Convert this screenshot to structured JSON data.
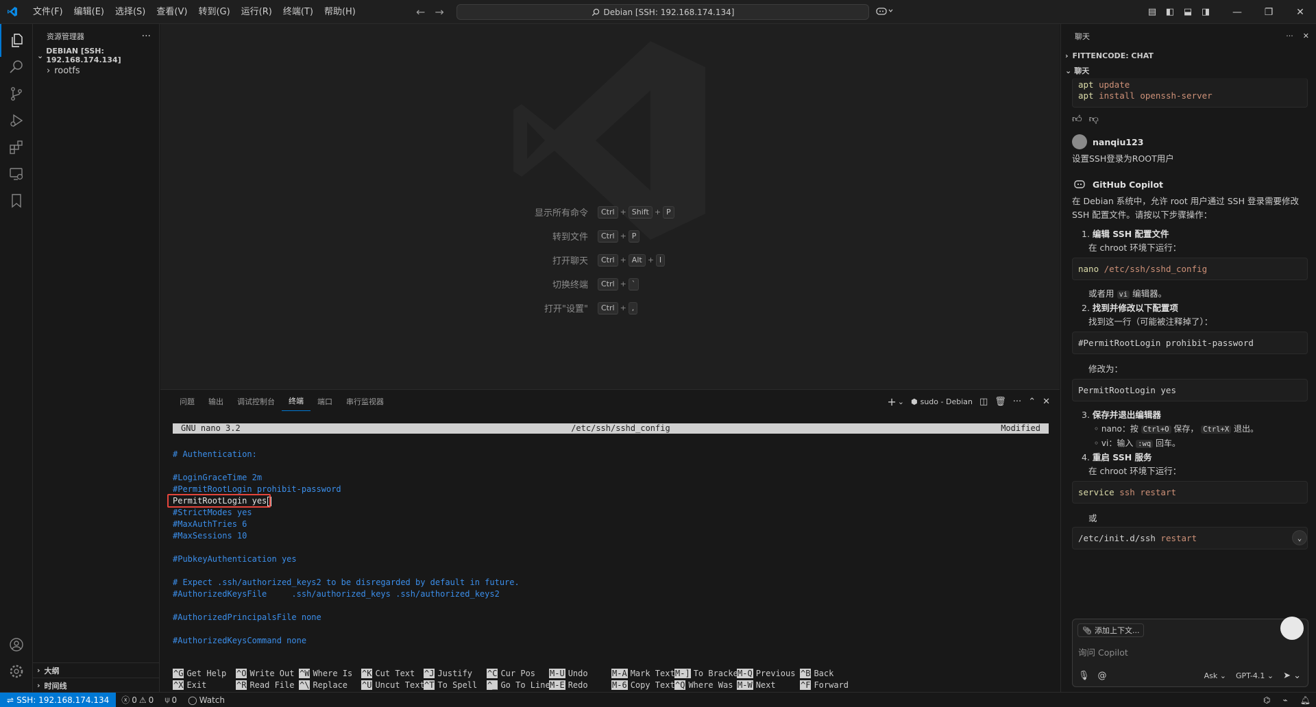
{
  "titlebar": {
    "menu": [
      "文件(F)",
      "编辑(E)",
      "选择(S)",
      "查看(V)",
      "转到(G)",
      "运行(R)",
      "终端(T)",
      "帮助(H)"
    ],
    "search_text": "Debian [SSH: 192.168.174.134]"
  },
  "sidebar": {
    "title": "资源管理器",
    "root": "DEBIAN [SSH: 192.168.174.134]",
    "items": [
      "rootfs"
    ],
    "outline": "大纲",
    "timeline": "时间线"
  },
  "editor": {
    "shortcuts": [
      {
        "label": "显示所有命令",
        "keys": [
          "Ctrl",
          "Shift",
          "P"
        ]
      },
      {
        "label": "转到文件",
        "keys": [
          "Ctrl",
          "P"
        ]
      },
      {
        "label": "打开聊天",
        "keys": [
          "Ctrl",
          "Alt",
          "I"
        ]
      },
      {
        "label": "切换终端",
        "keys": [
          "Ctrl",
          "`"
        ]
      },
      {
        "label": "打开\"设置\"",
        "keys": [
          "Ctrl",
          ","
        ]
      }
    ]
  },
  "panel": {
    "tabs": [
      "问题",
      "输出",
      "调试控制台",
      "终端",
      "端口",
      "串行监视器"
    ],
    "active_tab": "终端",
    "terminal_name": "sudo - Debian"
  },
  "terminal": {
    "nano_version": "GNU nano 3.2",
    "file": "/etc/ssh/sshd_config",
    "status": "Modified",
    "lines": [
      {
        "text": "",
        "style": "w"
      },
      {
        "text": "# Authentication:",
        "style": "c"
      },
      {
        "text": "",
        "style": "w"
      },
      {
        "text": "#LoginGraceTime 2m",
        "style": "c"
      },
      {
        "text": "#PermitRootLogin prohibit-password",
        "style": "c"
      },
      {
        "text": "PermitRootLogin yes",
        "style": "w"
      },
      {
        "text": "#StrictModes yes",
        "style": "c"
      },
      {
        "text": "#MaxAuthTries 6",
        "style": "c"
      },
      {
        "text": "#MaxSessions 10",
        "style": "c"
      },
      {
        "text": "",
        "style": "w"
      },
      {
        "text": "#PubkeyAuthentication yes",
        "style": "c"
      },
      {
        "text": "",
        "style": "w"
      },
      {
        "text": "# Expect .ssh/authorized_keys2 to be disregarded by default in future.",
        "style": "c"
      },
      {
        "text": "#AuthorizedKeysFile     .ssh/authorized_keys .ssh/authorized_keys2",
        "style": "c"
      },
      {
        "text": "",
        "style": "w"
      },
      {
        "text": "#AuthorizedPrincipalsFile none",
        "style": "c"
      },
      {
        "text": "",
        "style": "w"
      },
      {
        "text": "#AuthorizedKeysCommand none",
        "style": "c"
      }
    ],
    "help": [
      [
        {
          "k": "^G",
          "t": "Get Help"
        },
        {
          "k": "^X",
          "t": "Exit"
        }
      ],
      [
        {
          "k": "^O",
          "t": "Write Out"
        },
        {
          "k": "^R",
          "t": "Read File"
        }
      ],
      [
        {
          "k": "^W",
          "t": "Where Is"
        },
        {
          "k": "^\\",
          "t": "Replace"
        }
      ],
      [
        {
          "k": "^K",
          "t": "Cut Text"
        },
        {
          "k": "^U",
          "t": "Uncut Text"
        }
      ],
      [
        {
          "k": "^J",
          "t": "Justify"
        },
        {
          "k": "^T",
          "t": "To Spell"
        }
      ],
      [
        {
          "k": "^C",
          "t": "Cur Pos"
        },
        {
          "k": "^_",
          "t": "Go To Line"
        }
      ],
      [
        {
          "k": "M-U",
          "t": "Undo"
        },
        {
          "k": "M-E",
          "t": "Redo"
        }
      ],
      [
        {
          "k": "M-A",
          "t": "Mark Text"
        },
        {
          "k": "M-6",
          "t": "Copy Text"
        }
      ],
      [
        {
          "k": "M-]",
          "t": "To Bracket"
        },
        {
          "k": "^Q",
          "t": "Where Was"
        }
      ],
      [
        {
          "k": "M-Q",
          "t": "Previous"
        },
        {
          "k": "M-W",
          "t": "Next"
        }
      ],
      [
        {
          "k": "^B",
          "t": "Back"
        },
        {
          "k": "^F",
          "t": "Forward"
        }
      ]
    ]
  },
  "chat": {
    "title": "聊天",
    "fittencode": "FITTENCODE: CHAT",
    "section": "聊天",
    "code_top": {
      "l1_cmd": "apt",
      "l1_arg": "update",
      "l2_cmd": "apt",
      "l2_arg": "install openssh-server"
    },
    "user_name": "nanqiu123",
    "user_msg": "设置SSH登录为ROOT用户",
    "bot_name": "GitHub Copilot",
    "intro": "在 Debian 系统中，允许 root 用户通过 SSH 登录需要修改 SSH 配置文件。请按以下步骤操作：",
    "step1_title": "编辑 SSH 配置文件",
    "step1_sub": "在 chroot 环境下运行：",
    "code1_cmd": "nano",
    "code1_arg": "/etc/ssh/sshd_config",
    "or_use": "或者用",
    "vi": "vi",
    "editor_suffix": "编辑器。",
    "step2_title": "找到并修改以下配置项",
    "step2_sub": "找到这一行（可能被注释掉了）：",
    "code2": "#PermitRootLogin prohibit-password",
    "change_to": "修改为：",
    "code3": "PermitRootLogin yes",
    "step3_title": "保存并退出编辑器",
    "b1_pre": "nano：按",
    "b1_k1": "Ctrl+O",
    "b1_mid": "保存，",
    "b1_k2": "Ctrl+X",
    "b1_end": "退出。",
    "b2_pre": "vi：输入",
    "b2_k": ":wq",
    "b2_end": "回车。",
    "step4_title": "重启 SSH 服务",
    "step4_sub": "在 chroot 环境下运行：",
    "code4_cmd": "service",
    "code4_arg": "ssh restart",
    "or": "或",
    "code5_cmd": "/etc/init.d/ssh",
    "code5_arg": "restart",
    "input_context": "添加上下文...",
    "input_placeholder": "询问 Copilot",
    "mode": "Ask",
    "model": "GPT-4.1"
  },
  "statusbar": {
    "remote": "SSH: 192.168.174.134",
    "errors": "0",
    "warnings": "0",
    "ports": "0",
    "watch": "Watch"
  }
}
